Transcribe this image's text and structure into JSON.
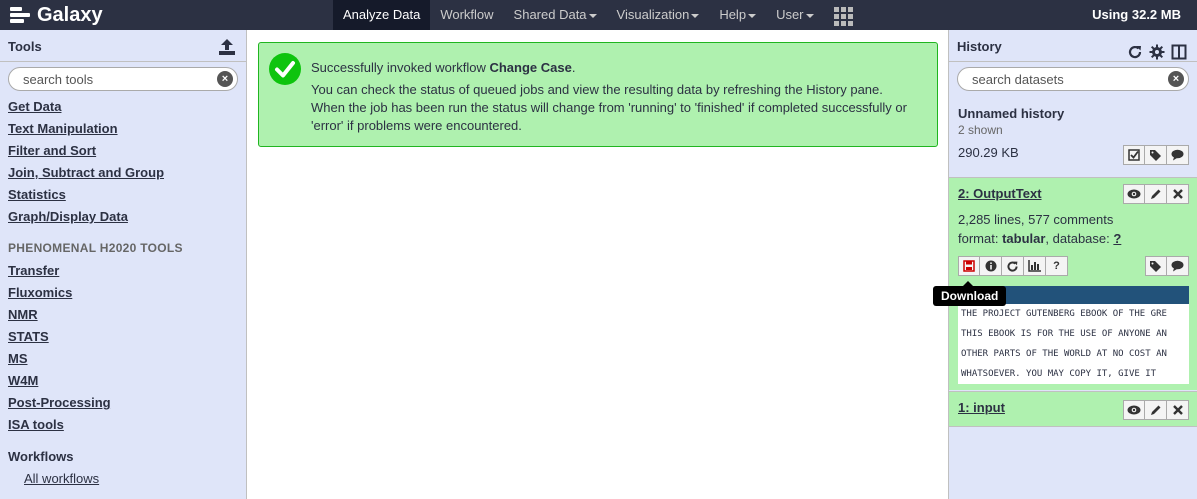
{
  "masthead": {
    "brand": "Galaxy",
    "nav": [
      {
        "label": "Analyze Data",
        "dropdown": false,
        "active": true
      },
      {
        "label": "Workflow",
        "dropdown": false,
        "active": false
      },
      {
        "label": "Shared Data",
        "dropdown": true,
        "active": false
      },
      {
        "label": "Visualization",
        "dropdown": true,
        "active": false
      },
      {
        "label": "Help",
        "dropdown": true,
        "active": false
      },
      {
        "label": "User",
        "dropdown": true,
        "active": false
      }
    ],
    "usage": "Using 32.2 MB"
  },
  "tools": {
    "title": "Tools",
    "search_placeholder": "search tools",
    "sections": [
      "Get Data",
      "Text Manipulation",
      "Filter and Sort",
      "Join, Subtract and Group",
      "Statistics",
      "Graph/Display Data"
    ],
    "phenomenal_label": "PHENOMENAL H2020 TOOLS",
    "phenomenal_sections": [
      "Transfer",
      "Fluxomics",
      "NMR",
      "STATS",
      "MS",
      "W4M",
      "Post-Processing",
      "ISA tools"
    ],
    "workflows_title": "Workflows",
    "all_workflows": "All workflows"
  },
  "alert": {
    "prefix": "Successfully invoked workflow ",
    "workflow_name": "Change Case",
    "suffix": ".",
    "line1": "You can check the status of queued jobs and view the resulting data by refreshing the History pane.",
    "line2": "When the job has been run the status will change from 'running' to 'finished' if completed successfully or 'error' if problems were encountered."
  },
  "history": {
    "title": "History",
    "search_placeholder": "search datasets",
    "name": "Unnamed history",
    "shown": "2 shown",
    "size": "290.29 KB",
    "datasets": [
      {
        "title": "2: OutputText",
        "summary": "2,285 lines, 577 comments",
        "format_label": "format: ",
        "format": "tabular",
        "database_label": ", database: ",
        "database": "?",
        "peek": [
          "THE PROJECT GUTENBERG EBOOK OF THE GRE",
          "THIS EBOOK IS FOR THE USE OF ANYONE AN",
          "OTHER PARTS OF THE WORLD AT NO COST AN",
          "WHATSOEVER.  YOU MAY COPY IT, GIVE IT"
        ],
        "help_label": "?"
      },
      {
        "title": "1: input"
      }
    ],
    "tooltip": "Download"
  },
  "colors": {
    "masthead": "#2c3143",
    "panel": "#dfe5f9",
    "ok_bg": "#aff1af",
    "ok_border": "#20b520",
    "check": "#0ec40e",
    "peek_header": "#22527a"
  }
}
